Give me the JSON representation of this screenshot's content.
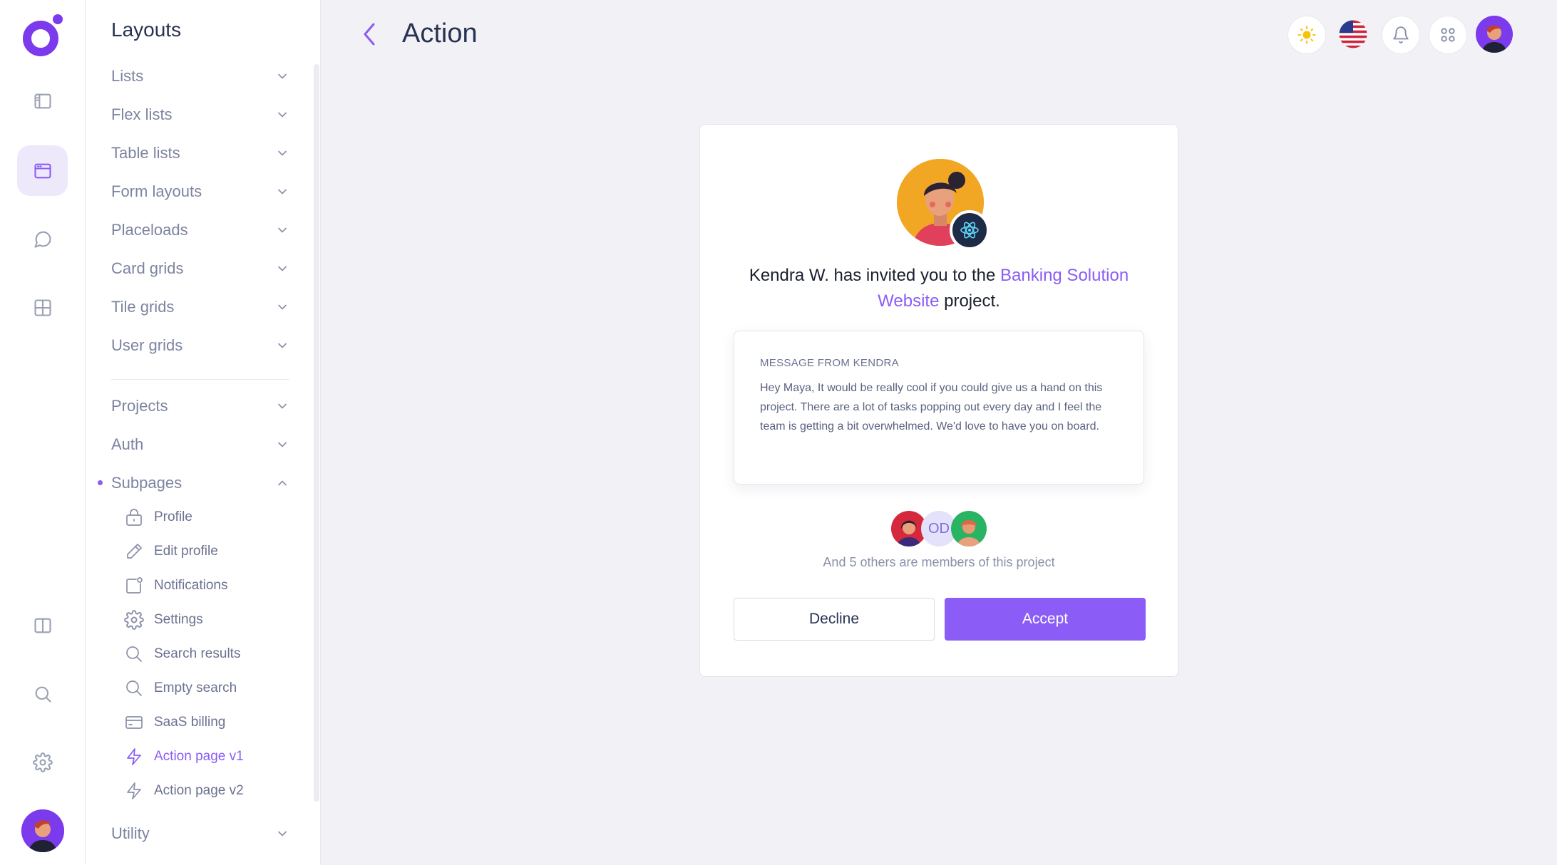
{
  "header": {
    "title": "Action"
  },
  "sidebar": {
    "title": "Layouts",
    "items": [
      {
        "label": "Lists"
      },
      {
        "label": "Flex lists"
      },
      {
        "label": "Table lists"
      },
      {
        "label": "Form layouts"
      },
      {
        "label": "Placeloads"
      },
      {
        "label": "Card grids"
      },
      {
        "label": "Tile grids"
      },
      {
        "label": "User grids"
      },
      {
        "label": "Projects"
      },
      {
        "label": "Auth"
      },
      {
        "label": "Subpages"
      },
      {
        "label": "Utility"
      }
    ],
    "subpages": [
      {
        "label": "Profile",
        "icon": "lock-icon"
      },
      {
        "label": "Edit profile",
        "icon": "pencil-icon"
      },
      {
        "label": "Notifications",
        "icon": "notification-icon"
      },
      {
        "label": "Settings",
        "icon": "gear-icon"
      },
      {
        "label": "Search results",
        "icon": "search-icon"
      },
      {
        "label": "Empty search",
        "icon": "search-icon"
      },
      {
        "label": "SaaS billing",
        "icon": "credit-card-icon"
      },
      {
        "label": "Action page v1",
        "icon": "lightning-icon"
      },
      {
        "label": "Action page v2",
        "icon": "lightning-icon"
      }
    ],
    "active_subpage": "Action page v1"
  },
  "invite": {
    "text_before": "Kendra W. has invited you to the ",
    "project_link": "Banking Solution Website",
    "text_after": " project.",
    "message_label": "MESSAGE FROM KENDRA",
    "message_body": "Hey Maya, It would be really cool if you could give us a hand on this project. There are a lot of tasks popping out every day and I feel the team is getting a bit overwhelmed. We'd love to have you on board.",
    "member_initials": "OD",
    "members_text": "And 5 others are members of this project",
    "decline_label": "Decline",
    "accept_label": "Accept"
  },
  "colors": {
    "accent": "#8b5cf6",
    "background": "#f1f1f6"
  }
}
